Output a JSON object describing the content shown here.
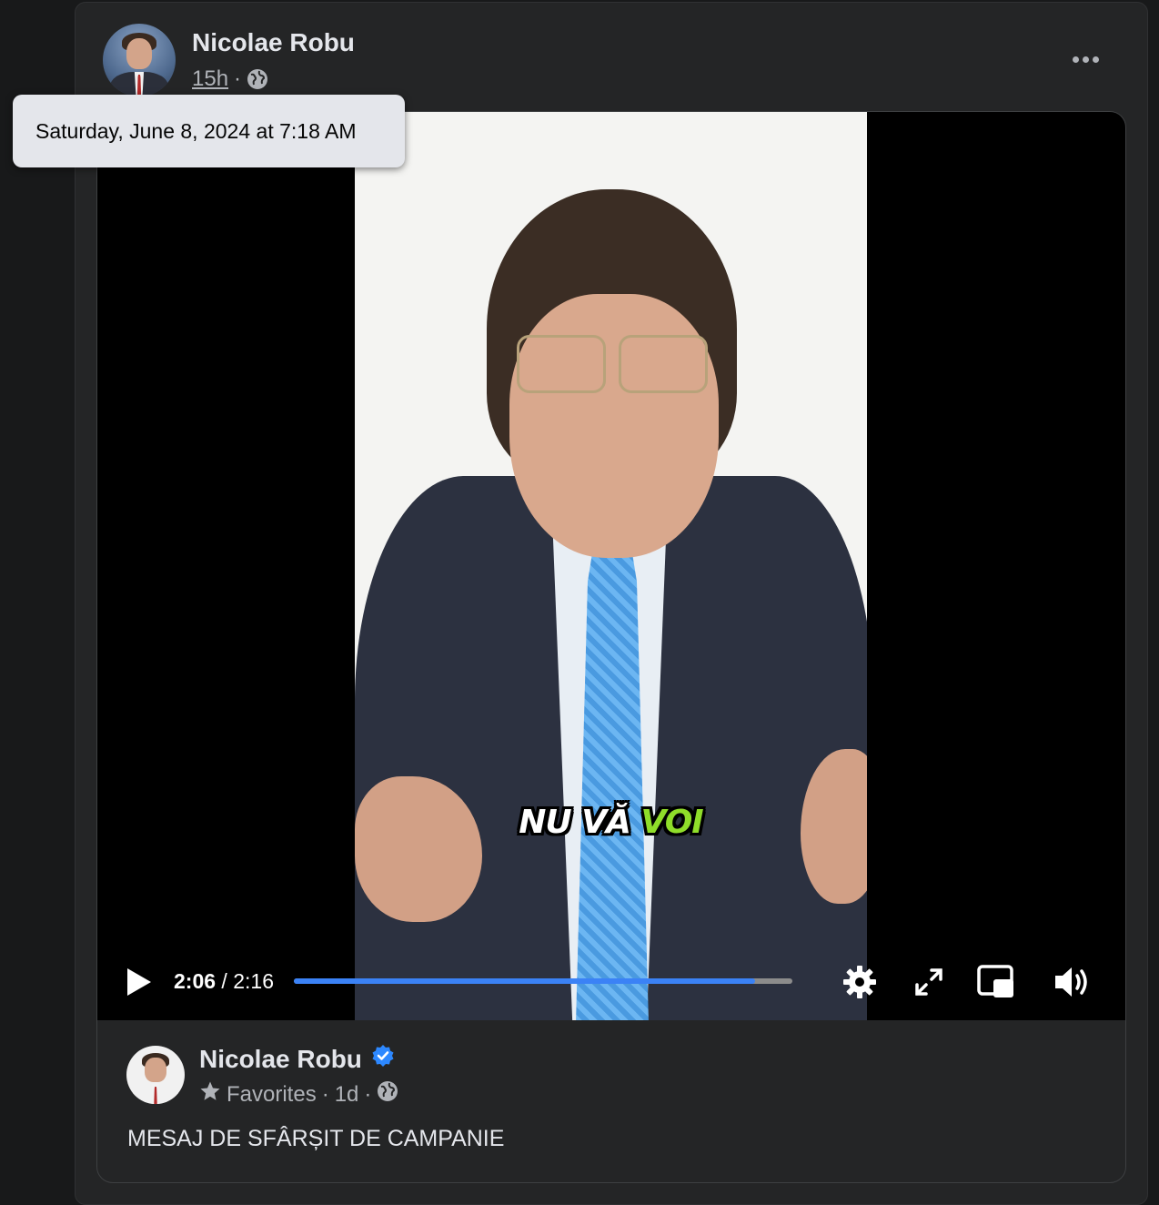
{
  "post": {
    "author": "Nicolae Robu",
    "time": "15h",
    "separator": "·",
    "privacy_icon": "globe-icon"
  },
  "tooltip": {
    "text": "Saturday, June 8, 2024 at 7:18 AM"
  },
  "video": {
    "caption_white": "NU VĂ",
    "caption_highlight": "VOI",
    "current_time": "2:06",
    "time_separator": " / ",
    "duration": "2:16",
    "progress": 0.926,
    "accent_color": "#3b82f6",
    "caption_highlight_color": "#8fdd2a",
    "controls": [
      "play-icon",
      "settings-icon",
      "fullscreen-icon",
      "picture-in-picture-icon",
      "volume-icon"
    ]
  },
  "shared_post": {
    "author": "Nicolae Robu",
    "verified": true,
    "audience": "Favorites",
    "separator": "·",
    "time": "1d",
    "separator2": "·",
    "text": "MESAJ DE SFÂRȘIT DE CAMPANIE"
  }
}
